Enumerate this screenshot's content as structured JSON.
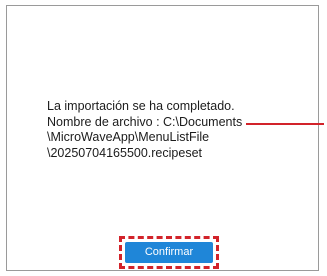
{
  "dialog": {
    "message_lines": [
      "La importación se ha completado.",
      "Nombre de archivo : C:\\Documents",
      "\\MicroWaveApp\\MenuListFile",
      "\\20250704165500.recipeset"
    ],
    "confirm_label": "Confirmar"
  },
  "colors": {
    "accent": "#1f86d8",
    "annotation": "#d2232a"
  }
}
